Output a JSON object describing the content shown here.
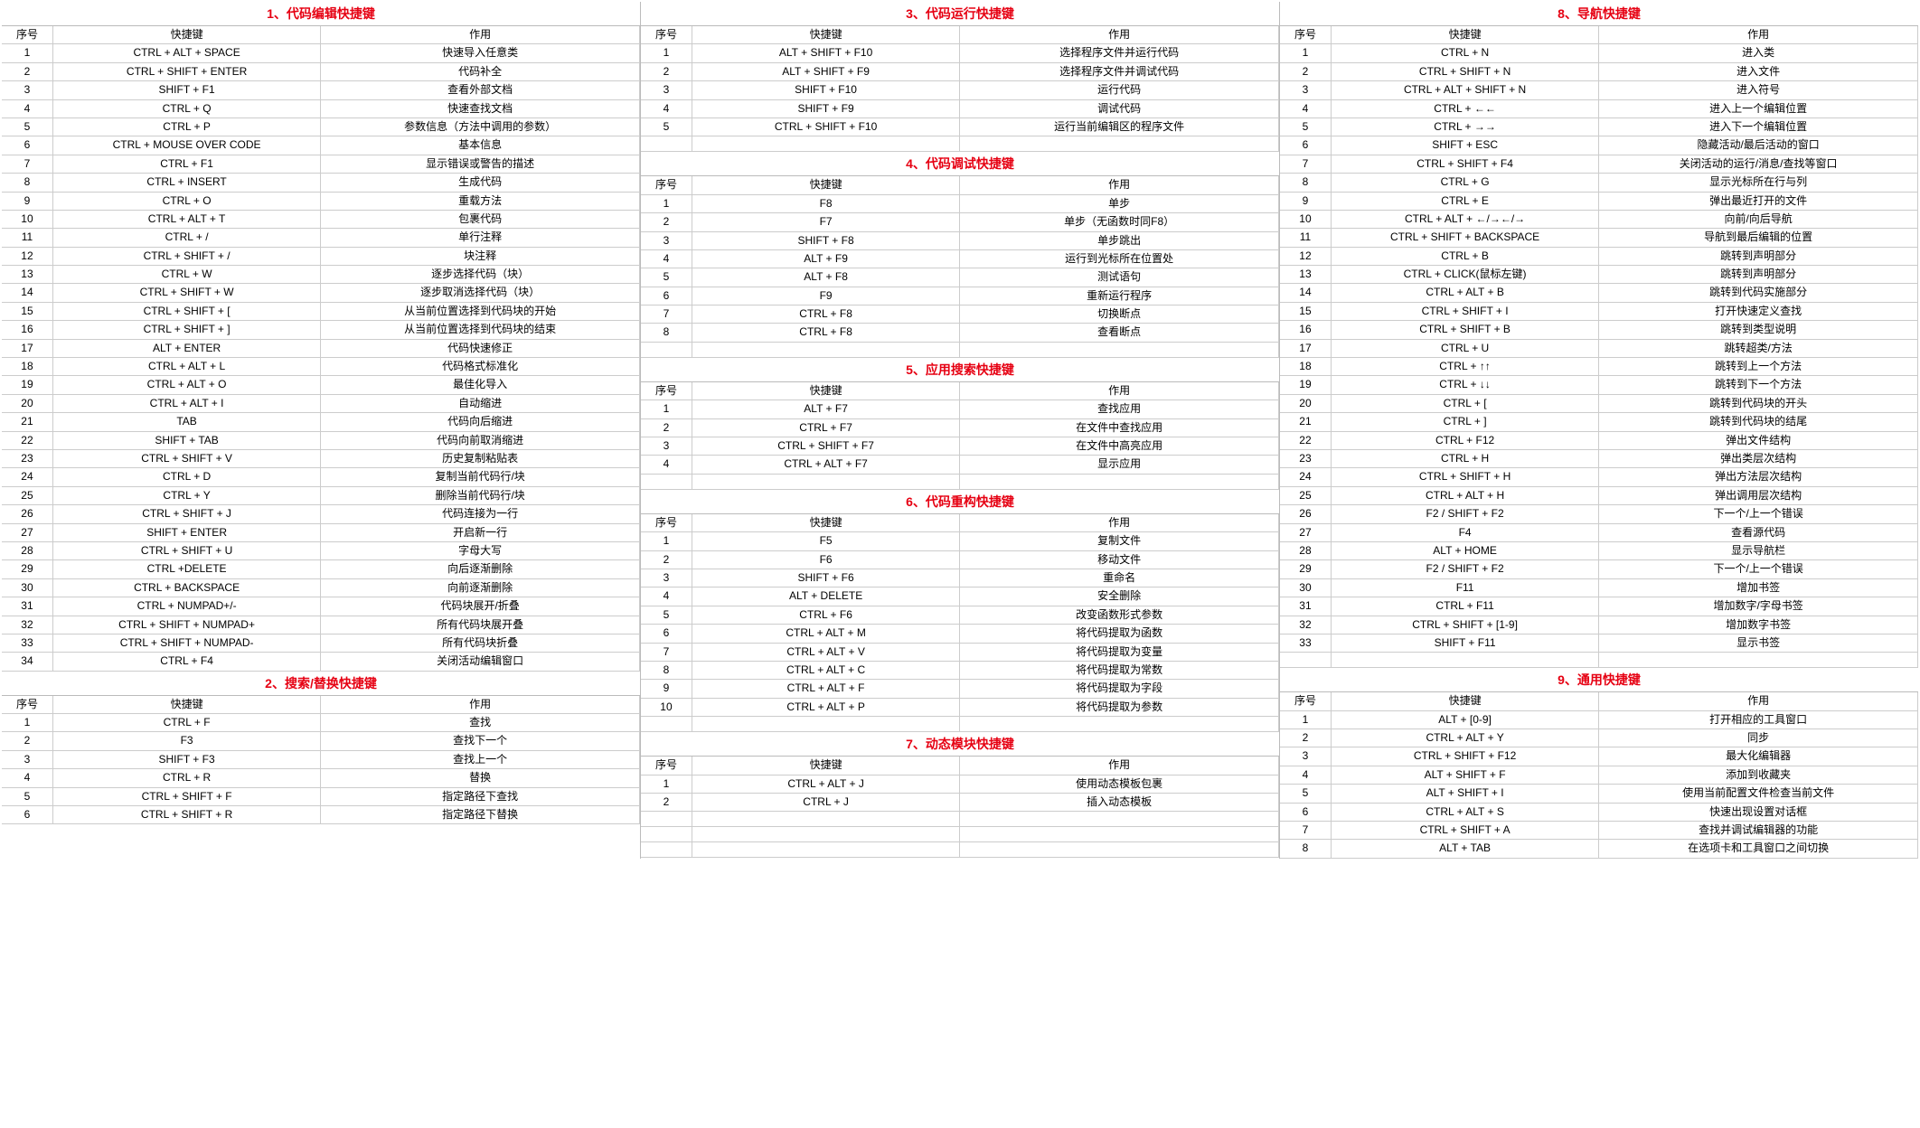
{
  "headers": {
    "idx": "序号",
    "key": "快捷键",
    "act": "作用"
  },
  "columns": [
    {
      "sections": [
        {
          "title": "1、代码编辑快捷键",
          "rows": [
            [
              "1",
              "CTRL + ALT + SPACE",
              "快速导入任意类"
            ],
            [
              "2",
              "CTRL + SHIFT + ENTER",
              "代码补全"
            ],
            [
              "3",
              "SHIFT + F1",
              "查看外部文档"
            ],
            [
              "4",
              "CTRL + Q",
              "快速查找文档"
            ],
            [
              "5",
              "CTRL + P",
              "参数信息（方法中调用的参数）"
            ],
            [
              "6",
              "CTRL + MOUSE OVER CODE",
              "基本信息"
            ],
            [
              "7",
              "CTRL + F1",
              "显示错误或警告的描述"
            ],
            [
              "8",
              "CTRL + INSERT",
              "生成代码"
            ],
            [
              "9",
              "CTRL + O",
              "重载方法"
            ],
            [
              "10",
              "CTRL + ALT + T",
              "包裹代码"
            ],
            [
              "11",
              "CTRL + /",
              "单行注释"
            ],
            [
              "12",
              "CTRL + SHIFT + /",
              "块注释"
            ],
            [
              "13",
              "CTRL + W",
              "逐步选择代码（块）"
            ],
            [
              "14",
              "CTRL + SHIFT + W",
              "逐步取消选择代码（块）"
            ],
            [
              "15",
              "CTRL + SHIFT + [",
              "从当前位置选择到代码块的开始"
            ],
            [
              "16",
              "CTRL + SHIFT + ]",
              "从当前位置选择到代码块的结束"
            ],
            [
              "17",
              "ALT + ENTER",
              "代码快速修正"
            ],
            [
              "18",
              "CTRL + ALT + L",
              "代码格式标准化"
            ],
            [
              "19",
              "CTRL + ALT + O",
              "最佳化导入"
            ],
            [
              "20",
              "CTRL + ALT + I",
              "自动缩进"
            ],
            [
              "21",
              "TAB",
              "代码向后缩进"
            ],
            [
              "22",
              "SHIFT + TAB",
              "代码向前取消缩进"
            ],
            [
              "23",
              "CTRL + SHIFT + V",
              "历史复制粘贴表"
            ],
            [
              "24",
              "CTRL + D",
              "复制当前代码行/块"
            ],
            [
              "25",
              "CTRL + Y",
              "删除当前代码行/块"
            ],
            [
              "26",
              "CTRL + SHIFT + J",
              "代码连接为一行"
            ],
            [
              "27",
              "SHIFT + ENTER",
              "开启新一行"
            ],
            [
              "28",
              "CTRL + SHIFT + U",
              "字母大写"
            ],
            [
              "29",
              "CTRL +DELETE",
              "向后逐渐删除"
            ],
            [
              "30",
              "CTRL + BACKSPACE",
              "向前逐渐删除"
            ],
            [
              "31",
              "CTRL + NUMPAD+/-",
              "代码块展开/折叠"
            ],
            [
              "32",
              "CTRL + SHIFT + NUMPAD+",
              "所有代码块展开叠"
            ],
            [
              "33",
              "CTRL + SHIFT + NUMPAD-",
              "所有代码块折叠"
            ],
            [
              "34",
              "CTRL + F4",
              "关闭活动编辑窗口"
            ]
          ]
        },
        {
          "title": "2、搜索/替换快捷键",
          "rows": [
            [
              "1",
              "CTRL + F",
              "查找"
            ],
            [
              "2",
              "F3",
              "查找下一个"
            ],
            [
              "3",
              "SHIFT + F3",
              "查找上一个"
            ],
            [
              "4",
              "CTRL + R",
              "替换"
            ],
            [
              "5",
              "CTRL + SHIFT + F",
              "指定路径下查找"
            ],
            [
              "6",
              "CTRL + SHIFT + R",
              "指定路径下替换"
            ]
          ]
        }
      ]
    },
    {
      "sections": [
        {
          "title": "3、代码运行快捷键",
          "rows": [
            [
              "1",
              "ALT + SHIFT + F10",
              "选择程序文件并运行代码"
            ],
            [
              "2",
              "ALT + SHIFT + F9",
              "选择程序文件并调试代码"
            ],
            [
              "3",
              "SHIFT + F10",
              "运行代码"
            ],
            [
              "4",
              "SHIFT + F9",
              "调试代码"
            ],
            [
              "5",
              "CTRL + SHIFT + F10",
              "运行当前编辑区的程序文件"
            ]
          ],
          "trailingBlank": 1
        },
        {
          "title": "4、代码调试快捷键",
          "rows": [
            [
              "1",
              "F8",
              "单步"
            ],
            [
              "2",
              "F7",
              "单步（无函数时同F8）"
            ],
            [
              "3",
              "SHIFT + F8",
              "单步跳出"
            ],
            [
              "4",
              "ALT + F9",
              "运行到光标所在位置处"
            ],
            [
              "5",
              "ALT + F8",
              "测试语句"
            ],
            [
              "6",
              "F9",
              "重新运行程序"
            ],
            [
              "7",
              "CTRL + F8",
              "切换断点"
            ],
            [
              "8",
              "CTRL + F8",
              "查看断点"
            ]
          ],
          "trailingBlank": 1
        },
        {
          "title": "5、应用搜索快捷键",
          "rows": [
            [
              "1",
              "ALT + F7",
              "查找应用"
            ],
            [
              "2",
              "CTRL + F7",
              "在文件中查找应用"
            ],
            [
              "3",
              "CTRL + SHIFT + F7",
              "在文件中高亮应用"
            ],
            [
              "4",
              "CTRL + ALT + F7",
              "显示应用"
            ]
          ],
          "trailingBlank": 1
        },
        {
          "title": "6、代码重构快捷键",
          "rows": [
            [
              "1",
              "F5",
              "复制文件"
            ],
            [
              "2",
              "F6",
              "移动文件"
            ],
            [
              "3",
              "SHIFT + F6",
              "重命名"
            ],
            [
              "4",
              "ALT + DELETE",
              "安全删除"
            ],
            [
              "5",
              "CTRL + F6",
              "改变函数形式参数"
            ],
            [
              "6",
              "CTRL + ALT + M",
              "将代码提取为函数"
            ],
            [
              "7",
              "CTRL + ALT + V",
              "将代码提取为变量"
            ],
            [
              "8",
              "CTRL + ALT + C",
              "将代码提取为常数"
            ],
            [
              "9",
              "CTRL + ALT + F",
              "将代码提取为字段"
            ],
            [
              "10",
              "CTRL + ALT + P",
              "将代码提取为参数"
            ]
          ],
          "trailingBlank": 1
        },
        {
          "title": "7、动态模块快捷键",
          "rows": [
            [
              "1",
              "CTRL + ALT + J",
              "使用动态模板包裹"
            ],
            [
              "2",
              "CTRL + J",
              "插入动态模板"
            ]
          ],
          "trailingBlank": 3
        }
      ]
    },
    {
      "sections": [
        {
          "title": "8、导航快捷键",
          "rows": [
            [
              "1",
              "CTRL + N",
              "进入类"
            ],
            [
              "2",
              "CTRL + SHIFT + N",
              "进入文件"
            ],
            [
              "3",
              "CTRL + ALT + SHIFT + N",
              "进入符号"
            ],
            [
              "4",
              "CTRL + ←←",
              "进入上一个编辑位置"
            ],
            [
              "5",
              "CTRL + →→",
              "进入下一个编辑位置"
            ],
            [
              "6",
              "SHIFT + ESC",
              "隐藏活动/最后活动的窗口"
            ],
            [
              "7",
              "CTRL + SHIFT + F4",
              "关闭活动的运行/消息/查找等窗口"
            ],
            [
              "8",
              "CTRL + G",
              "显示光标所在行与列"
            ],
            [
              "9",
              "CTRL + E",
              "弹出最近打开的文件"
            ],
            [
              "10",
              "CTRL + ALT + ←/→←/→",
              "向前/向后导航"
            ],
            [
              "11",
              "CTRL + SHIFT + BACKSPACE",
              "导航到最后编辑的位置"
            ],
            [
              "12",
              "CTRL + B",
              "跳转到声明部分"
            ],
            [
              "13",
              "CTRL + CLICK(鼠标左键)",
              "跳转到声明部分"
            ],
            [
              "14",
              "CTRL + ALT + B",
              "跳转到代码实施部分"
            ],
            [
              "15",
              "CTRL + SHIFT + I",
              "打开快速定义查找"
            ],
            [
              "16",
              "CTRL + SHIFT + B",
              "跳转到类型说明"
            ],
            [
              "17",
              "CTRL + U",
              "跳转超类/方法"
            ],
            [
              "18",
              "CTRL + ↑↑",
              "跳转到上一个方法"
            ],
            [
              "19",
              "CTRL + ↓↓",
              "跳转到下一个方法"
            ],
            [
              "20",
              "CTRL + [",
              "跳转到代码块的开头"
            ],
            [
              "21",
              "CTRL + ]",
              "跳转到代码块的结尾"
            ],
            [
              "22",
              "CTRL + F12",
              "弹出文件结构"
            ],
            [
              "23",
              "CTRL + H",
              "弹出类层次结构"
            ],
            [
              "24",
              "CTRL + SHIFT + H",
              "弹出方法层次结构"
            ],
            [
              "25",
              "CTRL + ALT + H",
              "弹出调用层次结构"
            ],
            [
              "26",
              "F2 / SHIFT + F2",
              "下一个/上一个错误"
            ],
            [
              "27",
              "F4",
              "查看源代码"
            ],
            [
              "28",
              "ALT + HOME",
              "显示导航栏"
            ],
            [
              "29",
              "F2 / SHIFT + F2",
              "下一个/上一个错误"
            ],
            [
              "30",
              "F11",
              "增加书签"
            ],
            [
              "31",
              "CTRL + F11",
              "增加数字/字母书签"
            ],
            [
              "32",
              "CTRL + SHIFT + [1-9]",
              "增加数字书签"
            ],
            [
              "33",
              "SHIFT + F11",
              "显示书签"
            ]
          ],
          "trailingBlank": 1
        },
        {
          "title": "9、通用快捷键",
          "rows": [
            [
              "1",
              "ALT + [0-9]",
              "打开相应的工具窗口"
            ],
            [
              "2",
              "CTRL + ALT + Y",
              "同步"
            ],
            [
              "3",
              "CTRL + SHIFT + F12",
              "最大化编辑器"
            ],
            [
              "4",
              "ALT + SHIFT + F",
              "添加到收藏夹"
            ],
            [
              "5",
              "ALT + SHIFT + I",
              "使用当前配置文件检查当前文件"
            ],
            [
              "6",
              "CTRL + ALT + S",
              "快速出现设置对话框"
            ],
            [
              "7",
              "CTRL + SHIFT + A",
              "查找并调试编辑器的功能"
            ],
            [
              "8",
              "ALT + TAB",
              "在选项卡和工具窗口之间切换"
            ]
          ]
        }
      ]
    }
  ]
}
